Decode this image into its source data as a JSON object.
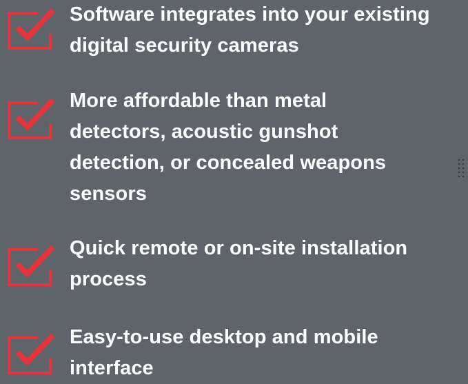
{
  "features": [
    {
      "icon": "checkbox-checked-icon",
      "lines": [
        "Software integrates into your existing",
        "digital security cameras"
      ]
    },
    {
      "icon": "checkbox-checked-icon",
      "lines": [
        "More affordable than metal",
        "detectors, acoustic gunshot",
        "detection, or concealed weapons",
        "sensors"
      ]
    },
    {
      "icon": "checkbox-checked-icon",
      "lines": [
        "Quick remote or on-site installation",
        "process"
      ]
    },
    {
      "icon": "checkbox-checked-icon",
      "lines": [
        "Easy-to-use desktop and mobile",
        "interface"
      ]
    }
  ],
  "colors": {
    "background": "#5f646b",
    "accent": "#e5343c",
    "text": "#ffffff"
  }
}
